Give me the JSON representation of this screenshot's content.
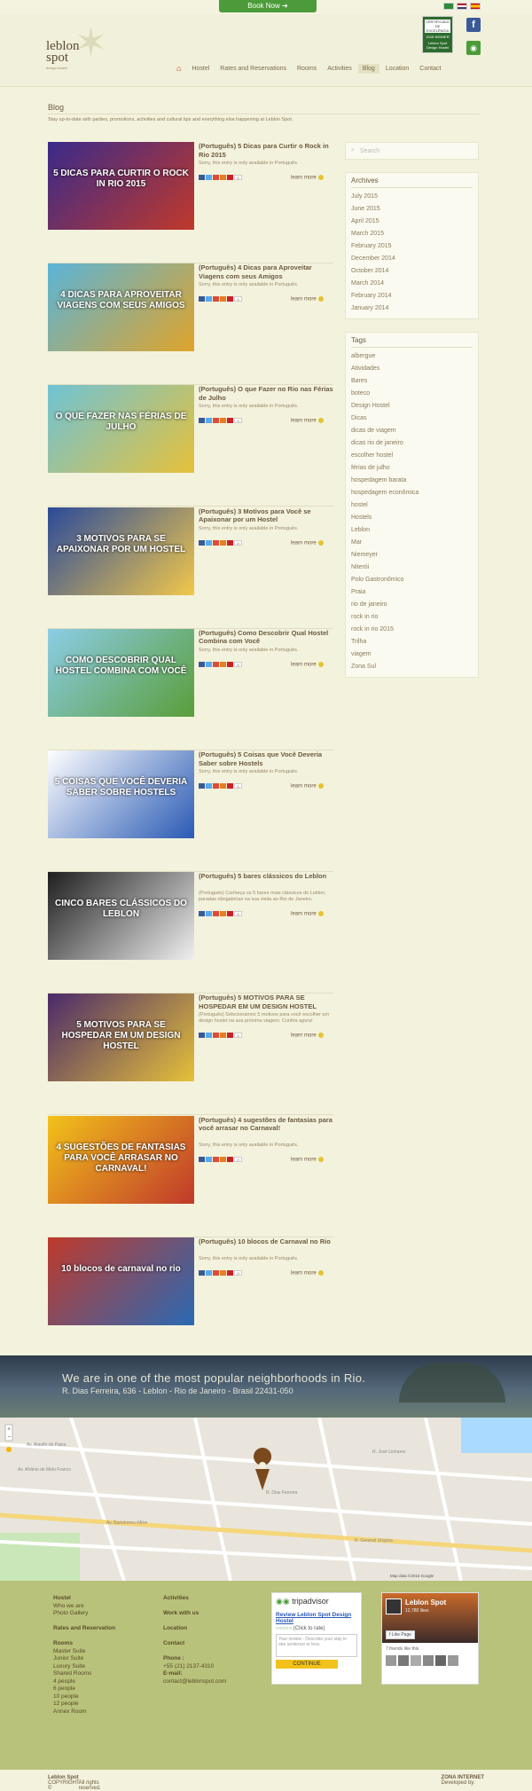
{
  "topbar": {
    "book_now": "Book Now",
    "flags": [
      "pt",
      "en",
      "es"
    ]
  },
  "logo": {
    "line1": "leblon",
    "line2": "spot",
    "tagline": "design hostel"
  },
  "badge": {
    "line1": "CERTIFICADO DE EXCELÊNCIA",
    "line2": "2015 WINNER",
    "line3": "Leblon Spot Design Hostel"
  },
  "nav": {
    "items": [
      "Hostel",
      "Rates and Reservations",
      "Rooms",
      "Activities",
      "Blog",
      "Location",
      "Contact"
    ],
    "active": "Blog"
  },
  "page": {
    "title": "Blog",
    "intro": "Stay up-to-date with parties, promotions, activities and cultural tips and everything else happening at Leblon Spot."
  },
  "posts": [
    {
      "title": "(Português) 5 Dicas para Curtir o Rock in Rio 2015",
      "excerpt": "Sorry, this entry is only available in Português.",
      "count": "0",
      "learn": "learn more",
      "img_text": "5 DICAS PARA CURTIR O ROCK IN RIO 2015",
      "colors": [
        "#3a2a8a",
        "#c0392b"
      ]
    },
    {
      "title": "(Português) 4 Dicas para Aproveitar Viagens com seus Amigos",
      "excerpt": "Sorry, this entry is only available in Português.",
      "count": "0",
      "learn": "learn more",
      "img_text": "4 DICAS PARA APROVEITAR VIAGENS COM SEUS AMIGOS",
      "colors": [
        "#5ab4d8",
        "#e0a42a"
      ]
    },
    {
      "title": "(Português) O que Fazer no Rio nas Férias de Julho",
      "excerpt": "Sorry, this entry is only available in Português.",
      "count": "0",
      "learn": "learn more",
      "img_text": "O QUE FAZER NAS FÉRIAS DE JULHO",
      "colors": [
        "#6ec3d6",
        "#e6c13a"
      ]
    },
    {
      "title": "(Português) 3 Motivos para Você se Apaixonar por um Hostel",
      "excerpt": "Sorry, this entry is only available in Português.",
      "count": "0",
      "learn": "learn more",
      "img_text": "3 MOTIVOS PARA SE APAIXONAR POR UM HOSTEL",
      "colors": [
        "#2a4a9a",
        "#f2c84a"
      ]
    },
    {
      "title": "(Português) Como Descobrir Qual Hostel Combina com Você",
      "excerpt": "Sorry, this entry is only available in Português.",
      "count": "0",
      "learn": "learn more",
      "img_text": "COMO DESCOBRIR QUAL HOSTEL COMBINA COM VOCÊ",
      "colors": [
        "#8ccde6",
        "#5a9e3a"
      ]
    },
    {
      "title": "(Português) 5 Coisas que Você Deveria Saber sobre Hostels",
      "excerpt": "Sorry, this entry is only available in Português.",
      "count": "0",
      "learn": "learn more",
      "img_text": "5 COISAS QUE VOCÊ DEVERIA SABER SOBRE HOSTELS",
      "colors": [
        "#ffffff",
        "#2a5ab4"
      ]
    },
    {
      "title": "(Português) 5 bares clássicos do Leblon",
      "excerpt": "(Português) Conheça os 5 bares mais clássicos do Leblon, paradas obrigatórias na sua visita ao Rio de Janeiro.",
      "count": "0",
      "learn": "learn more",
      "img_text": "CINCO BARES CLÁSSICOS DO LEBLON",
      "colors": [
        "#1e1e1e",
        "#f0f0f0"
      ]
    },
    {
      "title": "(Português) 5 MOTIVOS PARA SE HOSPEDAR EM UM DESIGN HOSTEL",
      "excerpt": "(Português) Selecionamos 5 motivos para você escolher um design hostel na sua próxima viagem. Confira agora!",
      "count": "0",
      "learn": "learn more",
      "img_text": "5 MOTIVOS PARA SE HOSPEDAR EM UM DESIGN HOSTEL",
      "colors": [
        "#4a2a6a",
        "#e6c13a"
      ]
    },
    {
      "title": "(Português) 4 sugestões de fantasias para você arrasar no Carnaval!",
      "excerpt": "Sorry, this entry is only available in Português.",
      "count": "0",
      "learn": "learn more",
      "img_text": "4 SUGESTÕES DE FANTASIAS PARA VOCÊ ARRASAR NO CARNAVAL!",
      "colors": [
        "#f2c21a",
        "#c0392b"
      ]
    },
    {
      "title": "(Português) 10 blocos de Carnaval no Rio",
      "excerpt": "Sorry, this entry is only available in Português.",
      "count": "0",
      "learn": "learn more",
      "img_text": "10 blocos de carnaval no rio",
      "colors": [
        "#c0392b",
        "#2a6ab4"
      ]
    }
  ],
  "sidebar": {
    "search_placeholder": "Search",
    "archives_title": "Archives",
    "archives": [
      "July 2015",
      "June 2015",
      "April 2015",
      "March 2015",
      "February 2015",
      "December 2014",
      "October 2014",
      "March 2014",
      "February 2014",
      "January 2014"
    ],
    "tags_title": "Tags",
    "tags": [
      "albergue",
      "Atividades",
      "Bares",
      "boteco",
      "Design Hostel",
      "Dicas",
      "dicas de viagem",
      "dicas rio de janeiro",
      "escolher hostel",
      "férias de julho",
      "hospedagem barata",
      "hospedagem econômica",
      "hostel",
      "Hostels",
      "Leblon",
      "Mar",
      "Niemeyer",
      "Niterói",
      "Polo Gastronômico",
      "Praia",
      "rio de janeiro",
      "rock in rio",
      "rock in rio 2015",
      "Trilha",
      "viagem",
      "Zona Sul"
    ]
  },
  "hero": {
    "headline": "We are in one of the most popular neighborhoods in Rio.",
    "address": "R. Dias Ferreira, 636 - Leblon - Rio de Janeiro - Brasil   22431-050"
  },
  "map": {
    "credit": "Map data ©2015 Google",
    "streets": [
      "Av. Ataulfo de Paiva",
      "R. Dias Ferreira",
      "Av. Bartolomeu Mitre",
      "R. General Urquiza",
      "Av. Afrânio de Melo Franco",
      "R. José Linhares"
    ]
  },
  "footer": {
    "col1": [
      {
        "text": "Hostel",
        "bold": true
      },
      {
        "text": "Who we are",
        "bold": false
      },
      {
        "text": "Photo Gallery",
        "bold": false
      },
      {
        "text": "",
        "bold": false
      },
      {
        "text": "Rates and Reservation",
        "bold": true
      },
      {
        "text": "",
        "bold": false
      },
      {
        "text": "Rooms",
        "bold": true
      },
      {
        "text": "Master Suite",
        "bold": false
      },
      {
        "text": "Junior Suite",
        "bold": false
      },
      {
        "text": "Luxury Suite",
        "bold": false
      },
      {
        "text": "Shared Rooms",
        "bold": false
      },
      {
        "text": "4 people",
        "bold": false
      },
      {
        "text": "6 people",
        "bold": false
      },
      {
        "text": "10 people",
        "bold": false
      },
      {
        "text": "12 people",
        "bold": false
      },
      {
        "text": "Annex Room",
        "bold": false
      }
    ],
    "col2": [
      {
        "text": "Activities",
        "bold": true
      },
      {
        "text": "",
        "bold": false
      },
      {
        "text": "Work with us",
        "bold": true
      },
      {
        "text": "",
        "bold": false
      },
      {
        "text": "Location",
        "bold": true
      },
      {
        "text": "",
        "bold": false
      },
      {
        "text": "Contact",
        "bold": true
      },
      {
        "text": "",
        "bold": false
      },
      {
        "text": "Phone :",
        "bold": true
      },
      {
        "text": "+55 (21) 2137-4310",
        "bold": false
      },
      {
        "text": "E-mail:",
        "bold": true
      },
      {
        "text": "contact@leblonspot.com",
        "bold": false
      }
    ],
    "tripadvisor": {
      "brand": "tripadvisor",
      "title": "Review Leblon Spot Design Hostel",
      "rate": "(Click to rate)",
      "textarea": "Your review - Describe your stay in one sentence or less.",
      "button": "CONTINUE"
    },
    "facebook": {
      "page": "Leblon Spot",
      "likes": "12,780 likes",
      "like_btn": "Like Page",
      "friends": "7 friends like this"
    }
  },
  "copyright": {
    "left_pre": "COPYRIGHT ©",
    "left_name": "Leblon Spot",
    "left_post": "All rights reserved.",
    "right_pre": "Developed by:",
    "right_name": "ZONA INTERNET"
  }
}
